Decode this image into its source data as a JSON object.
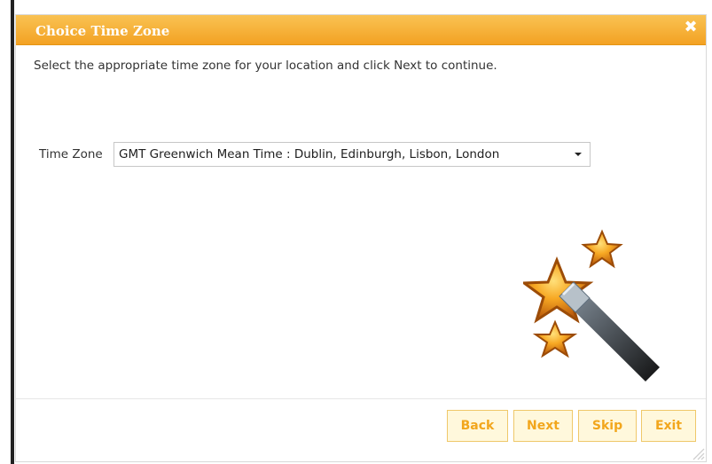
{
  "dialog": {
    "title": "Choice Time Zone",
    "close_glyph": "✖",
    "instruction": "Select the appropriate time zone for your location and click Next to continue."
  },
  "timezone": {
    "label": "Time Zone",
    "selected": "GMT Greenwich Mean Time : Dublin, Edinburgh, Lisbon, London"
  },
  "buttons": {
    "back": "Back",
    "next": "Next",
    "skip": "Skip",
    "exit": "Exit"
  },
  "icons": {
    "close": "close-icon",
    "dropdown": "chevron-down-icon",
    "illustration": "magic-wand-stars-icon",
    "resize": "resize-grip-icon"
  },
  "colors": {
    "titlebar": "#f3a223",
    "button_text": "#f2a61c",
    "button_bg": "#fff8dc",
    "button_border": "#efc86a"
  }
}
